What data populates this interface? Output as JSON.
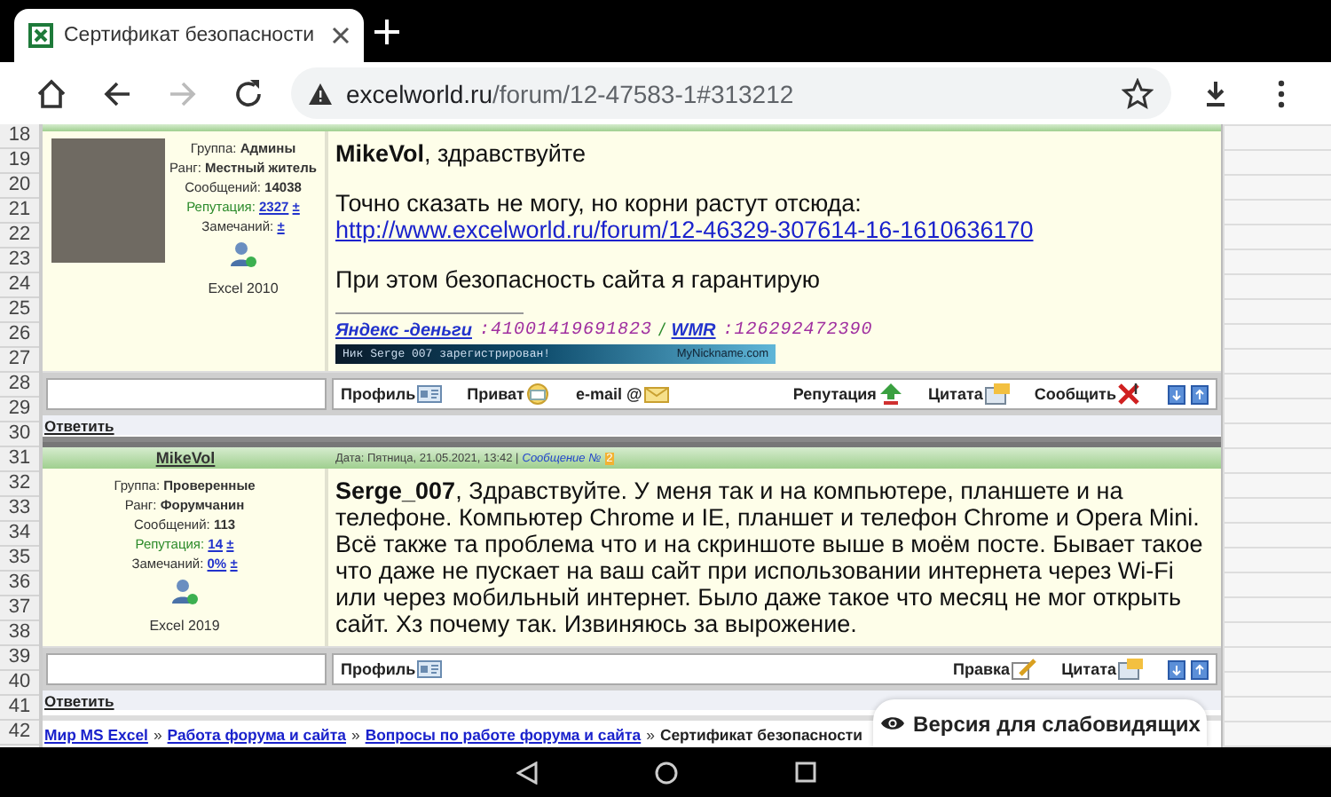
{
  "browser": {
    "tab_title": "Сертификат безопасности",
    "forward_disabled": true,
    "url_host": "excelworld.ru",
    "url_path": "/forum/12-47583-1#313212"
  },
  "row_numbers": [
    "18",
    "19",
    "20",
    "21",
    "22",
    "23",
    "24",
    "25",
    "26",
    "27",
    "28",
    "29",
    "30",
    "31",
    "32",
    "33",
    "34",
    "35",
    "36",
    "37",
    "38",
    "39",
    "40",
    "41",
    "42"
  ],
  "posts": [
    {
      "has_photo": true,
      "user": {
        "group": "Группа: **Админы**",
        "rank": "Ранг: **Местный житель**",
        "messages": "Сообщений: **14038**",
        "reputation_label": "Репутация:",
        "reputation": "2327",
        "reputation_sign": "±",
        "warnings_label": "Замечаний:",
        "warnings_sign": "±",
        "version": "Excel 2010"
      },
      "paragraphs": [
        {
          "kind": "text",
          "text": "**MikeVol**, здравствуйте"
        },
        {
          "kind": "text",
          "text": "Точно сказать не могу, но корни растут отсюда:"
        },
        {
          "kind": "link",
          "text": "http://www.excelworld.ru/forum/12-46329-307614-16-1610636170"
        },
        {
          "kind": "text",
          "text": "При этом безопасность сайта я гарантирую"
        }
      ],
      "signature": {
        "wallet_label": "Яндекс -деньги",
        "wallet_value": ":41001419691823",
        "separator": "/",
        "wmr_label": "WMR",
        "wmr_value": ":126292472390",
        "banner_text": "Ник Serge 007 зарегистрирован!",
        "banner_site": "MyNickname.com"
      },
      "actions": [
        {
          "kind": "profile",
          "label": "Профиль"
        },
        {
          "kind": "private",
          "label": "Приват"
        },
        {
          "kind": "email",
          "label": "e-mail @"
        },
        {
          "kind": "reputation",
          "label": "Репутация"
        },
        {
          "kind": "quote",
          "label": "Цитата"
        },
        {
          "kind": "report",
          "label": "Сообщить"
        }
      ],
      "reply": "Ответить"
    },
    {
      "has_photo": false,
      "author": "MikeVol",
      "date": "Дата: Пятница, 21.05.2021, 13:42 |",
      "post_label": "Сообщение №",
      "post_number": "2",
      "user": {
        "group": "Группа: **Проверенные**",
        "rank": "Ранг: **Форумчанин**",
        "messages": "Сообщений: **113**",
        "reputation_label": "Репутация:",
        "reputation": "14",
        "reputation_sign": "±",
        "warnings_label": "Замечаний:",
        "warnings": "0%",
        "warnings_sign": "±",
        "version": "Excel 2019"
      },
      "paragraphs": [
        {
          "kind": "text",
          "text": "**Serge_007**, Здравствуйте. У меня так и на компьютере, планшете и на телефоне. Компьютер Chrome и IE, планшет и телефон Chrome и Opera Mini. Всё также та проблема что и на скриншоте выше в моём посте. Бывает такое что даже не пускает на ваш сайт при использовании интернета через Wi-Fi или через мобильный интернет. Было даже такое что месяц не мог открыть сайт. Хз почему так. Извиняюсь за вырожение."
        }
      ],
      "actions": [
        {
          "kind": "profile",
          "label": "Профиль"
        },
        {
          "kind": "edit",
          "label": "Правка"
        },
        {
          "kind": "quote",
          "label": "Цитата"
        }
      ],
      "reply": "Ответить"
    }
  ],
  "breadcrumb": [
    {
      "kind": "link",
      "text": "Мир MS Excel"
    },
    {
      "kind": "sep",
      "text": "»"
    },
    {
      "kind": "link",
      "text": "Работа форума и сайта"
    },
    {
      "kind": "sep",
      "text": "»"
    },
    {
      "kind": "link",
      "text": "Вопросы по работе форума и сайта"
    },
    {
      "kind": "sep",
      "text": "»"
    },
    {
      "kind": "current",
      "text": "Сертификат безопасности"
    }
  ],
  "accessibility_button": "Версия для слабовидящих"
}
